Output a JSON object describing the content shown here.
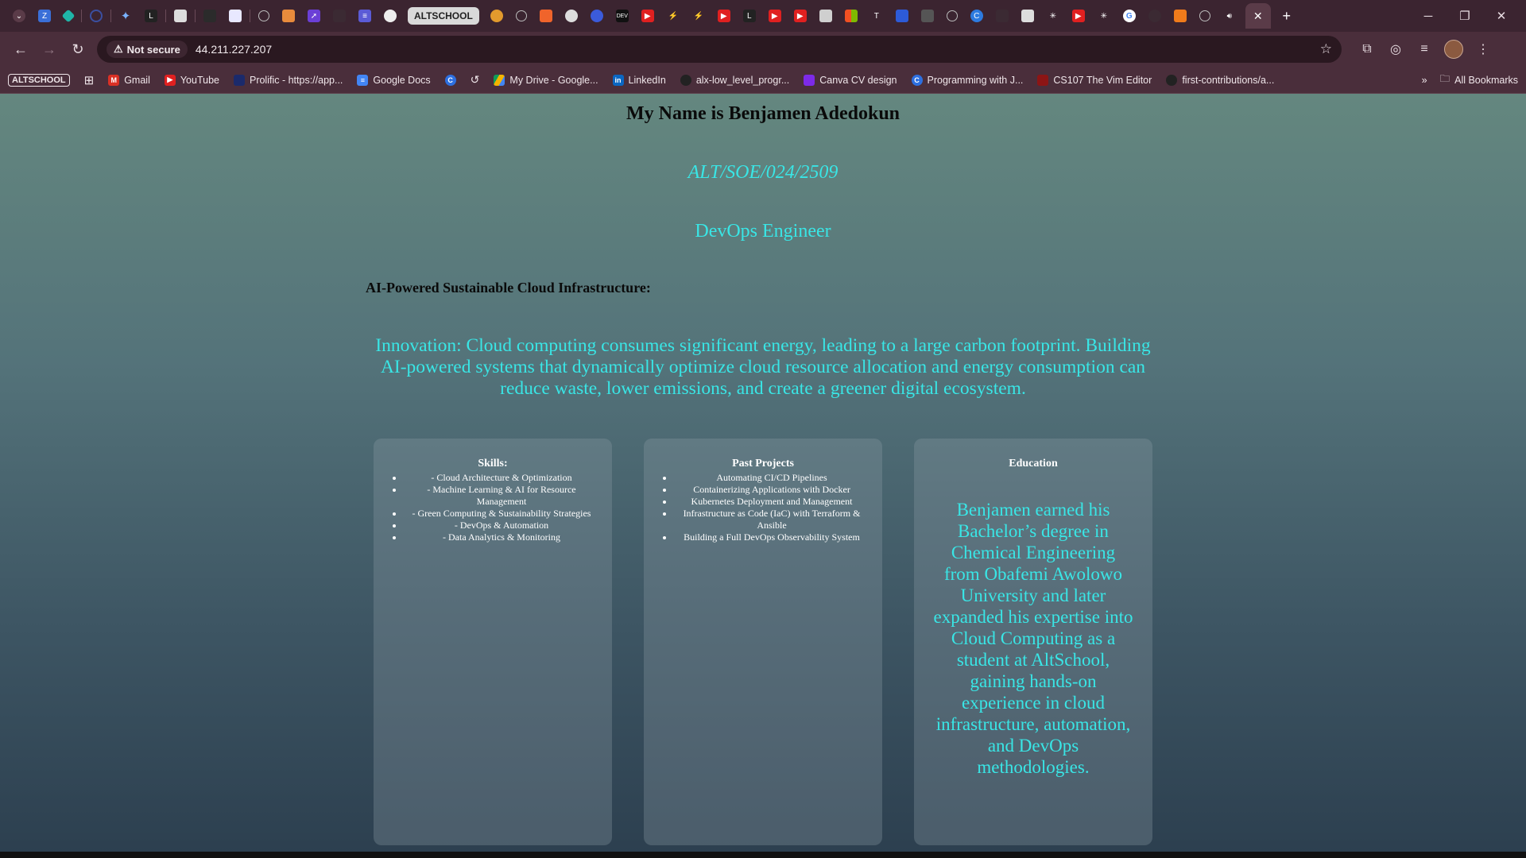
{
  "browser": {
    "tab_pill_label": "ALTSCHOOL",
    "address": "44.211.227.207",
    "security_label": "Not secure",
    "bookmarks": {
      "badge": "ALTSCHOOL",
      "items": [
        "Gmail",
        "YouTube",
        "Prolific - https://app...",
        "Google Docs",
        "My Drive - Google...",
        "LinkedIn",
        "alx-low_level_progr...",
        "Canva CV design",
        "Programming with J...",
        "CS107 The Vim Editor",
        "first-contributions/a..."
      ],
      "all_bookmarks": "All Bookmarks"
    },
    "colors": {
      "frame": "#3b2430",
      "toolbar": "#4a2e3b",
      "omnibox": "#2a1820"
    }
  },
  "page": {
    "name_heading": "My Name is Benjamen Adedokun",
    "student_id": "ALT/SOE/024/2509",
    "role": "DevOps Engineer",
    "project_title": "AI-Powered Sustainable Cloud Infrastructure:",
    "innovation": "Innovation: Cloud computing consumes significant energy, leading to a large carbon footprint. Building AI-powered systems that dynamically optimize cloud resource allocation and energy consumption can reduce waste, lower emissions, and create a greener digital ecosystem.",
    "skills": {
      "title": "Skills:",
      "items": [
        "- Cloud Architecture & Optimization",
        "- Machine Learning & AI for Resource Management",
        "- Green Computing & Sustainability Strategies",
        "- DevOps & Automation",
        "- Data Analytics & Monitoring"
      ]
    },
    "projects": {
      "title": "Past Projects",
      "items": [
        "Automating CI/CD Pipelines",
        "Containerizing Applications with Docker",
        "Kubernetes Deployment and Management",
        "Infrastructure as Code (IaC) with Terraform & Ansible",
        "Building a Full DevOps Observability System"
      ]
    },
    "education": {
      "title": "Education",
      "text": "Benjamen earned his Bachelor’s degree in Chemical Engineering from Obafemi Awolowo University and later expanded his expertise into Cloud Computing as a student at AltSchool, gaining hands-on experience in cloud infrastructure, automation, and DevOps methodologies."
    },
    "colors": {
      "accent": "#39e6e6",
      "heading": "#0a0a0a",
      "card_text": "#ffffff"
    }
  }
}
